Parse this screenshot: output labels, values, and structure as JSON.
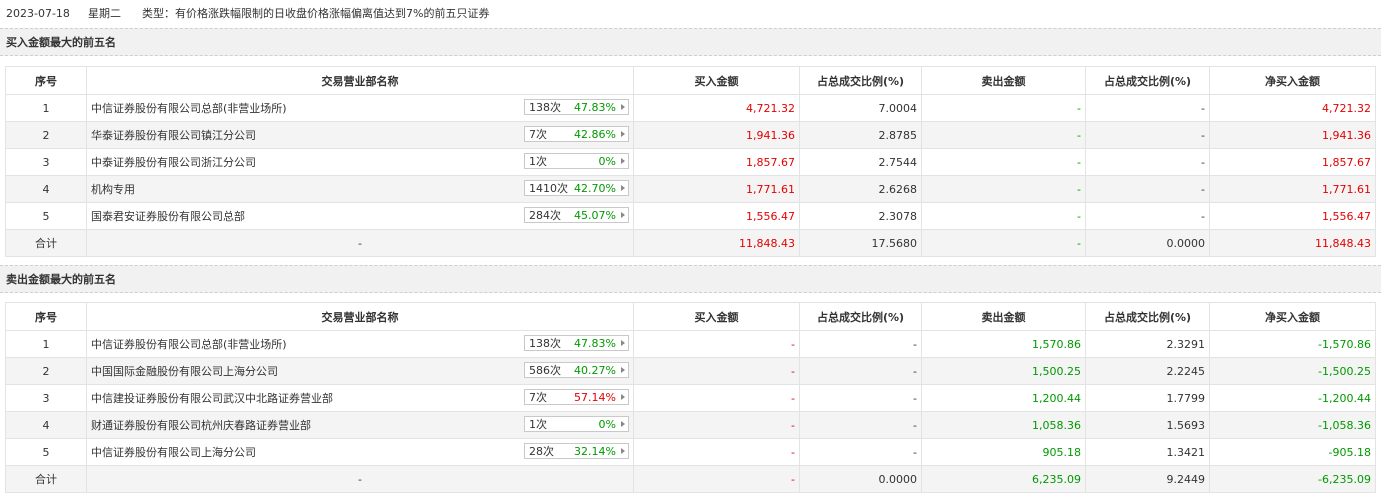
{
  "header": {
    "date": "2023-07-18",
    "weekday": "星期二",
    "type_text": "类型：有价格涨跌幅限制的日收盘价格涨幅偏离值达到7%的前五只证券"
  },
  "columns": [
    "序号",
    "交易营业部名称",
    "买入金额",
    "占总成交比例(%)",
    "卖出金额",
    "占总成交比例(%)",
    "净买入金额"
  ],
  "colors": {
    "up": "#e60000",
    "down": "#009900",
    "row_alt": "#f4f4f4",
    "section_bg": "#f1f1f1"
  },
  "buy_section": {
    "title": "买入金额最大的前五名",
    "rows": [
      {
        "idx": "1",
        "name": "中信证券股份有限公司总部(非营业场所)",
        "count": "138次",
        "pct": "47.83%",
        "pct_color": "green",
        "buy": "4,721.32",
        "buy_ratio": "7.0004",
        "sell": "-",
        "sell_ratio": "-",
        "net": "4,721.32"
      },
      {
        "idx": "2",
        "name": "华泰证券股份有限公司镇江分公司",
        "count": "7次",
        "pct": "42.86%",
        "pct_color": "green",
        "buy": "1,941.36",
        "buy_ratio": "2.8785",
        "sell": "-",
        "sell_ratio": "-",
        "net": "1,941.36"
      },
      {
        "idx": "3",
        "name": "中泰证券股份有限公司浙江分公司",
        "count": "1次",
        "pct": "0%",
        "pct_color": "green",
        "buy": "1,857.67",
        "buy_ratio": "2.7544",
        "sell": "-",
        "sell_ratio": "-",
        "net": "1,857.67"
      },
      {
        "idx": "4",
        "name": "机构专用",
        "count": "1410次",
        "pct": "42.70%",
        "pct_color": "green",
        "buy": "1,771.61",
        "buy_ratio": "2.6268",
        "sell": "-",
        "sell_ratio": "-",
        "net": "1,771.61"
      },
      {
        "idx": "5",
        "name": "国泰君安证券股份有限公司总部",
        "count": "284次",
        "pct": "45.07%",
        "pct_color": "green",
        "buy": "1,556.47",
        "buy_ratio": "2.3078",
        "sell": "-",
        "sell_ratio": "-",
        "net": "1,556.47"
      }
    ],
    "total": {
      "label": "合计",
      "name": "-",
      "buy": "11,848.43",
      "buy_ratio": "17.5680",
      "sell": "-",
      "sell_ratio": "0.0000",
      "net": "11,848.43"
    }
  },
  "sell_section": {
    "title": "卖出金额最大的前五名",
    "rows": [
      {
        "idx": "1",
        "name": "中信证券股份有限公司总部(非营业场所)",
        "count": "138次",
        "pct": "47.83%",
        "pct_color": "green",
        "buy": "-",
        "buy_ratio": "-",
        "sell": "1,570.86",
        "sell_ratio": "2.3291",
        "net": "-1,570.86"
      },
      {
        "idx": "2",
        "name": "中国国际金融股份有限公司上海分公司",
        "count": "586次",
        "pct": "40.27%",
        "pct_color": "green",
        "buy": "-",
        "buy_ratio": "-",
        "sell": "1,500.25",
        "sell_ratio": "2.2245",
        "net": "-1,500.25"
      },
      {
        "idx": "3",
        "name": "中信建投证券股份有限公司武汉中北路证券营业部",
        "count": "7次",
        "pct": "57.14%",
        "pct_color": "red",
        "buy": "-",
        "buy_ratio": "-",
        "sell": "1,200.44",
        "sell_ratio": "1.7799",
        "net": "-1,200.44"
      },
      {
        "idx": "4",
        "name": "财通证券股份有限公司杭州庆春路证券营业部",
        "count": "1次",
        "pct": "0%",
        "pct_color": "green",
        "buy": "-",
        "buy_ratio": "-",
        "sell": "1,058.36",
        "sell_ratio": "1.5693",
        "net": "-1,058.36"
      },
      {
        "idx": "5",
        "name": "中信证券股份有限公司上海分公司",
        "count": "28次",
        "pct": "32.14%",
        "pct_color": "green",
        "buy": "-",
        "buy_ratio": "-",
        "sell": "905.18",
        "sell_ratio": "1.3421",
        "net": "-905.18"
      }
    ],
    "total": {
      "label": "合计",
      "name": "-",
      "buy": "-",
      "buy_ratio": "0.0000",
      "sell": "6,235.09",
      "sell_ratio": "9.2449",
      "net": "-6,235.09"
    }
  }
}
